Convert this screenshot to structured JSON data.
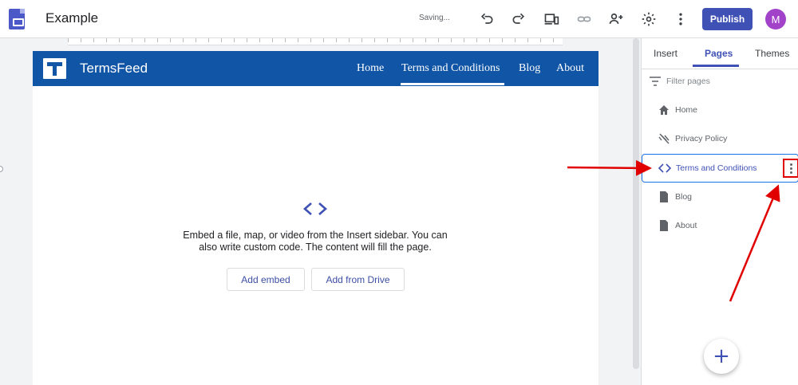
{
  "app": {
    "doc_title": "Example",
    "status": "Saving...",
    "publish_label": "Publish",
    "avatar_initial": "M",
    "colors": {
      "accent": "#3f51b5",
      "avatar": "#a142c9",
      "site_header": "#1155a6",
      "annotation": "#e00000"
    }
  },
  "toolbar_icons": [
    "undo-icon",
    "redo-icon",
    "preview-devices-icon",
    "link-icon",
    "share-person-icon",
    "settings-gear-icon",
    "more-vert-icon"
  ],
  "site": {
    "name": "TermsFeed",
    "nav": [
      "Home",
      "Terms and Conditions",
      "Blog",
      "About"
    ],
    "active_nav": "Terms and Conditions"
  },
  "embed": {
    "text": "Embed a file, map, or video from the Insert sidebar. You can also write custom code. The content will fill the page.",
    "add_embed_label": "Add embed",
    "add_drive_label": "Add from Drive"
  },
  "panel": {
    "tabs": [
      {
        "label": "Insert",
        "active": false
      },
      {
        "label": "Pages",
        "active": true
      },
      {
        "label": "Themes",
        "active": false
      }
    ],
    "filter_placeholder": "Filter pages",
    "pages": [
      {
        "label": "Home",
        "icon": "home-icon"
      },
      {
        "label": "Privacy Policy",
        "icon": "hidden-link-icon"
      },
      {
        "label": "Terms and Conditions",
        "icon": "code-icon",
        "selected": true
      },
      {
        "label": "Blog",
        "icon": "page-icon"
      },
      {
        "label": "About",
        "icon": "page-icon"
      }
    ],
    "fab_label": "+"
  }
}
